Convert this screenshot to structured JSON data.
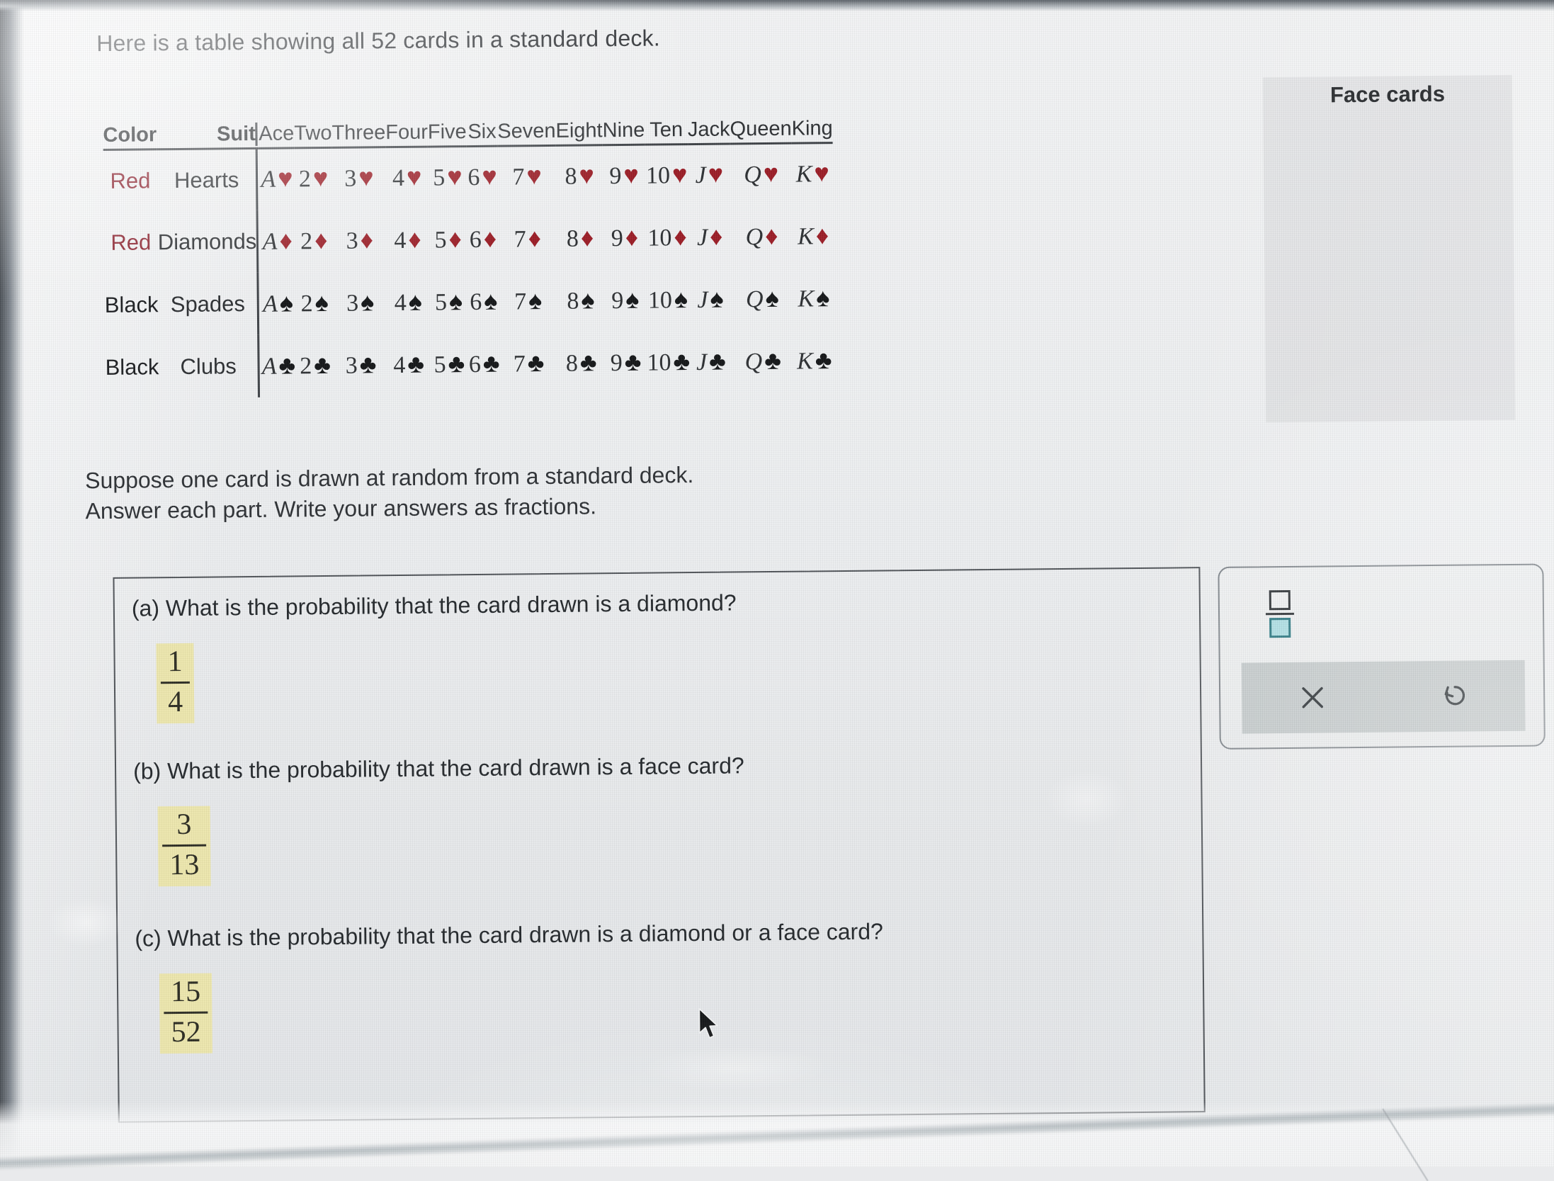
{
  "intro": "Here is a table showing all 52 cards in a standard deck.",
  "table": {
    "face_cards_label": "Face cards",
    "headers": {
      "color": "Color",
      "suit": "Suit",
      "ranks": [
        "Ace",
        "Two",
        "Three",
        "Four",
        "Five",
        "Six",
        "Seven",
        "Eight",
        "Nine",
        "Ten",
        "Jack",
        "Queen",
        "King"
      ]
    },
    "rank_symbols": [
      "A",
      "2",
      "3",
      "4",
      "5",
      "6",
      "7",
      "8",
      "9",
      "10",
      "J",
      "Q",
      "K"
    ],
    "rows": [
      {
        "color": "Red",
        "suit": "Hearts",
        "pip": "♥",
        "pip_color": "red",
        "suit_name": "hearts"
      },
      {
        "color": "Red",
        "suit": "Diamonds",
        "pip": "♦",
        "pip_color": "red",
        "suit_name": "diamonds"
      },
      {
        "color": "Black",
        "suit": "Spades",
        "pip": "♠",
        "pip_color": "black",
        "suit_name": "spades"
      },
      {
        "color": "Black",
        "suit": "Clubs",
        "pip": "♣",
        "pip_color": "black",
        "suit_name": "clubs"
      }
    ]
  },
  "prompt": {
    "line1": "Suppose one card is drawn at random from a standard deck.",
    "line2": "Answer each part. Write your answers as fractions."
  },
  "questions": [
    {
      "label": "(a) What is the probability that the card drawn is a diamond?",
      "answer": {
        "numerator": "1",
        "denominator": "4"
      }
    },
    {
      "label": "(b) What is the probability that the card drawn is a face card?",
      "answer": {
        "numerator": "3",
        "denominator": "13"
      }
    },
    {
      "label": "(c) What is the probability that the card drawn is a diamond or a face card?",
      "answer": {
        "numerator": "15",
        "denominator": "52"
      }
    }
  ],
  "tool_panel": {
    "fraction_tool_name": "fraction-template",
    "clear_label": "✕",
    "undo_label": "↺"
  },
  "colors": {
    "red_text": "#8d2330",
    "red_pip": "#9a1b24",
    "black_pip": "#121416",
    "highlight": "#ece6ac",
    "face_band": "rgba(168,172,176,0.19)",
    "teal_fill": "#a8dbe0"
  }
}
